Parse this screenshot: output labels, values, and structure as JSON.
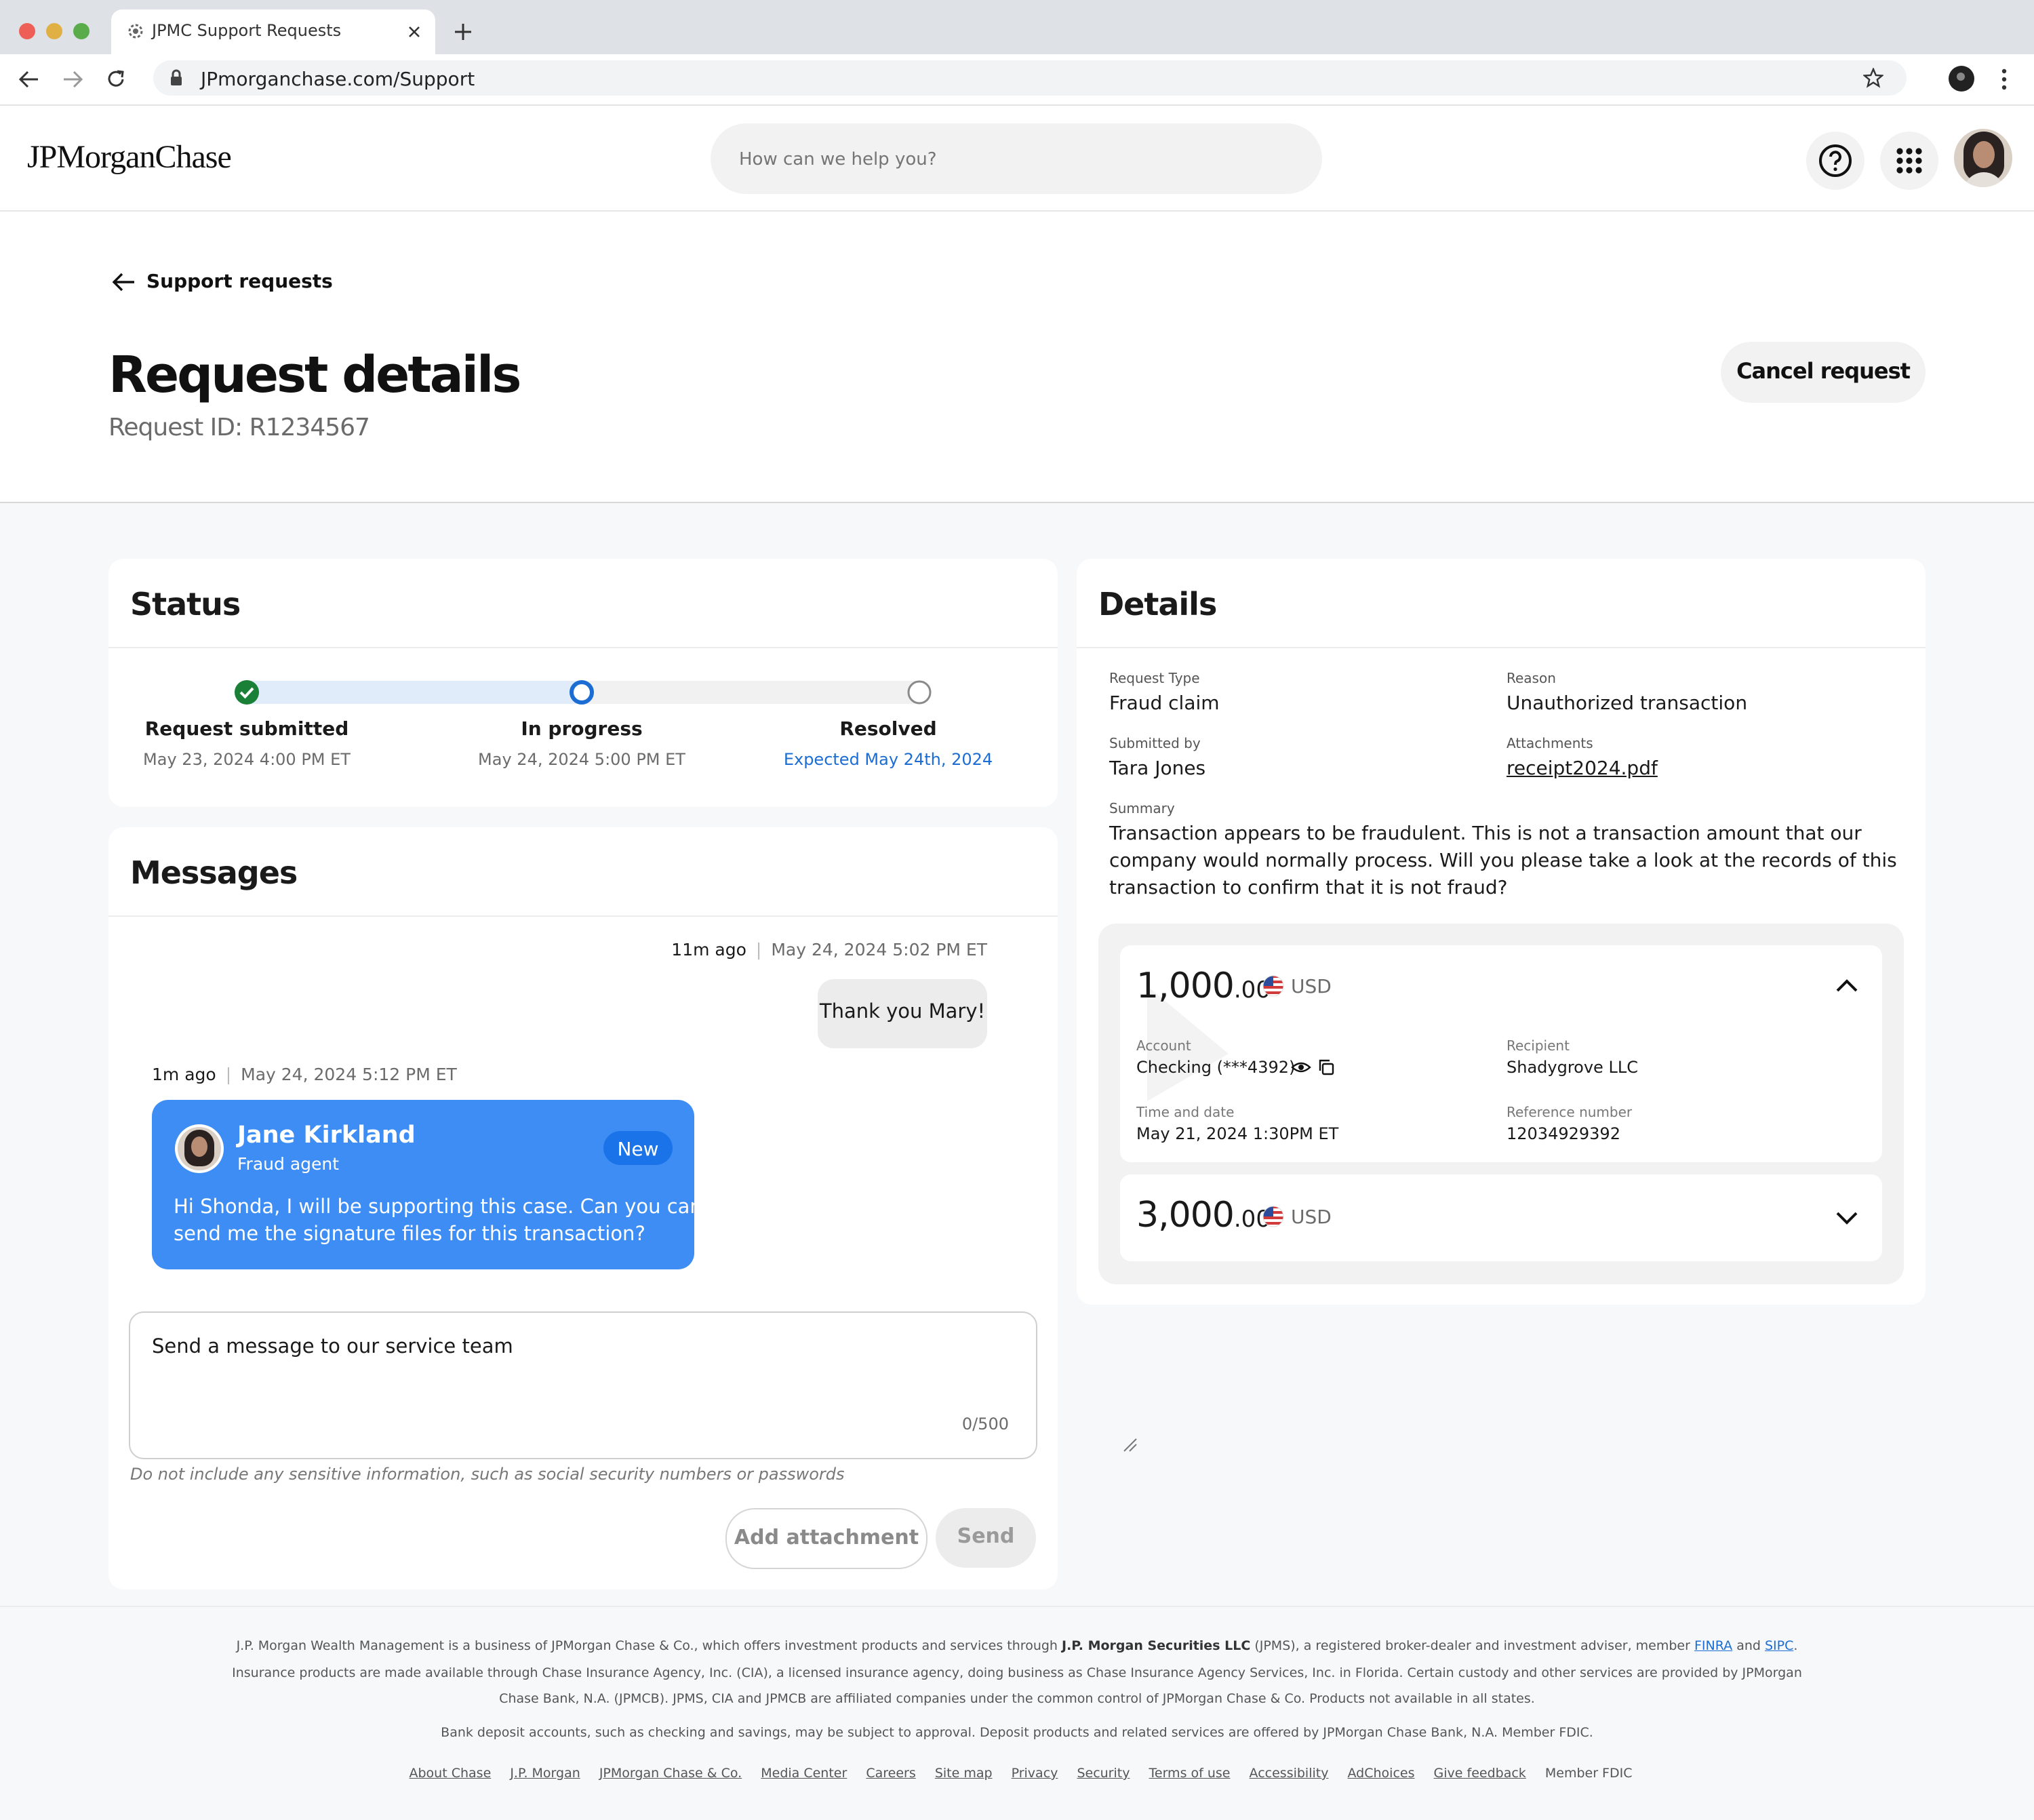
{
  "browser": {
    "tab_title": "JPMC Support Requests",
    "url": "JPmorganchase.com/Support",
    "traffic_colors": [
      "#ed5f57",
      "#e0b044",
      "#5aac4b"
    ]
  },
  "header": {
    "logo": "JPMorganChase",
    "search_placeholder": "How can we help you?",
    "help_icon": "question-circle-icon",
    "apps_icon": "grid-icon"
  },
  "page": {
    "back_label": "Support requests",
    "title": "Request details",
    "request_id": "Request ID: R1234567",
    "cancel_label": "Cancel request"
  },
  "status": {
    "title": "Status",
    "steps": [
      {
        "label": "Request submitted",
        "date": "May 23, 2024 4:00 PM ET",
        "state": "complete"
      },
      {
        "label": "In progress",
        "date": "May 24, 2024 5:00 PM ET",
        "state": "current"
      },
      {
        "label": "Resolved",
        "date": "Expected May 24th, 2024",
        "state": "pending"
      }
    ],
    "colors": {
      "complete": "#1a7f37",
      "current": "#1b6dd3",
      "track": "#e1ecfb"
    }
  },
  "messages": {
    "title": "Messages",
    "outgoing": {
      "relative": "11m ago",
      "timestamp": "May 24, 2024 5:02 PM ET",
      "text": "Thank you Mary!"
    },
    "incoming": {
      "relative": "1m ago",
      "timestamp": "May 24, 2024 5:12 PM ET",
      "name": "Jane Kirkland",
      "role": "Fraud agent",
      "badge": "New",
      "text_line1": "Hi Shonda, I will be supporting this case. Can you can",
      "text_line2": "send me the signature files for this transaction?",
      "color": "#3d8df5"
    },
    "composer": {
      "placeholder": "Send a message to our service team",
      "counter": "0/500",
      "hint": "Do not include any sensitive information, such as social security numbers or passwords",
      "attach_label": "Add attachment",
      "send_label": "Send"
    }
  },
  "details": {
    "title": "Details",
    "request_type_label": "Request Type",
    "request_type": "Fraud claim",
    "reason_label": "Reason",
    "reason": "Unauthorized transaction",
    "submitted_by_label": "Submitted by",
    "submitted_by": "Tara Jones",
    "attachments_label": "Attachments",
    "attachment": "receipt2024.pdf",
    "summary_label": "Summary",
    "summary_lines": [
      "Transaction appears to be fraudulent. This is not a transaction amount that our",
      "company would normally process. Will you please take a look at the records of this",
      "transaction to confirm that it is not fraud?"
    ],
    "transactions": [
      {
        "amount_main": "1,000",
        "amount_cents": ".00",
        "currency": "USD",
        "expanded": true,
        "account_label": "Account",
        "account": "Checking (***4392)",
        "recipient_label": "Recipient",
        "recipient": "Shadygrove LLC",
        "time_label": "Time and date",
        "time": "May 21, 2024 1:30PM ET",
        "ref_label": "Reference number",
        "ref": "12034929392"
      },
      {
        "amount_main": "3,000",
        "amount_cents": ".00",
        "currency": "USD",
        "expanded": false
      }
    ]
  },
  "footer": {
    "line1_a": "J.P. Morgan Wealth Management is a business of JPMorgan Chase & Co., which offers investment products and services through ",
    "line1_b": "J.P. Morgan Securities LLC",
    "line1_c": " (JPMS), a registered broker-dealer and investment adviser, member ",
    "finra": "FINRA",
    "and": " and ",
    "sipc": "SIPC",
    "period": ".",
    "line2": "Insurance products are made available through Chase Insurance Agency, Inc. (CIA), a licensed insurance agency, doing business as Chase Insurance Agency Services, Inc. in Florida. Certain custody and other services are provided by JPMorgan",
    "line3": "Chase Bank, N.A. (JPMCB). JPMS, CIA and JPMCB are affiliated companies under the common control of JPMorgan Chase & Co. Products not available in all states.",
    "line4": "Bank deposit accounts, such as checking and savings, may be subject to approval. Deposit products and related services are offered by JPMorgan Chase Bank, N.A. Member FDIC.",
    "links": [
      "About Chase",
      "J.P. Morgan",
      "JPMorgan Chase & Co.",
      "Media Center",
      "Careers",
      "Site map",
      "Privacy",
      "Security",
      "Terms of use",
      "Accessibility",
      "AdChoices",
      "Give feedback"
    ],
    "member": "Member FDIC"
  }
}
